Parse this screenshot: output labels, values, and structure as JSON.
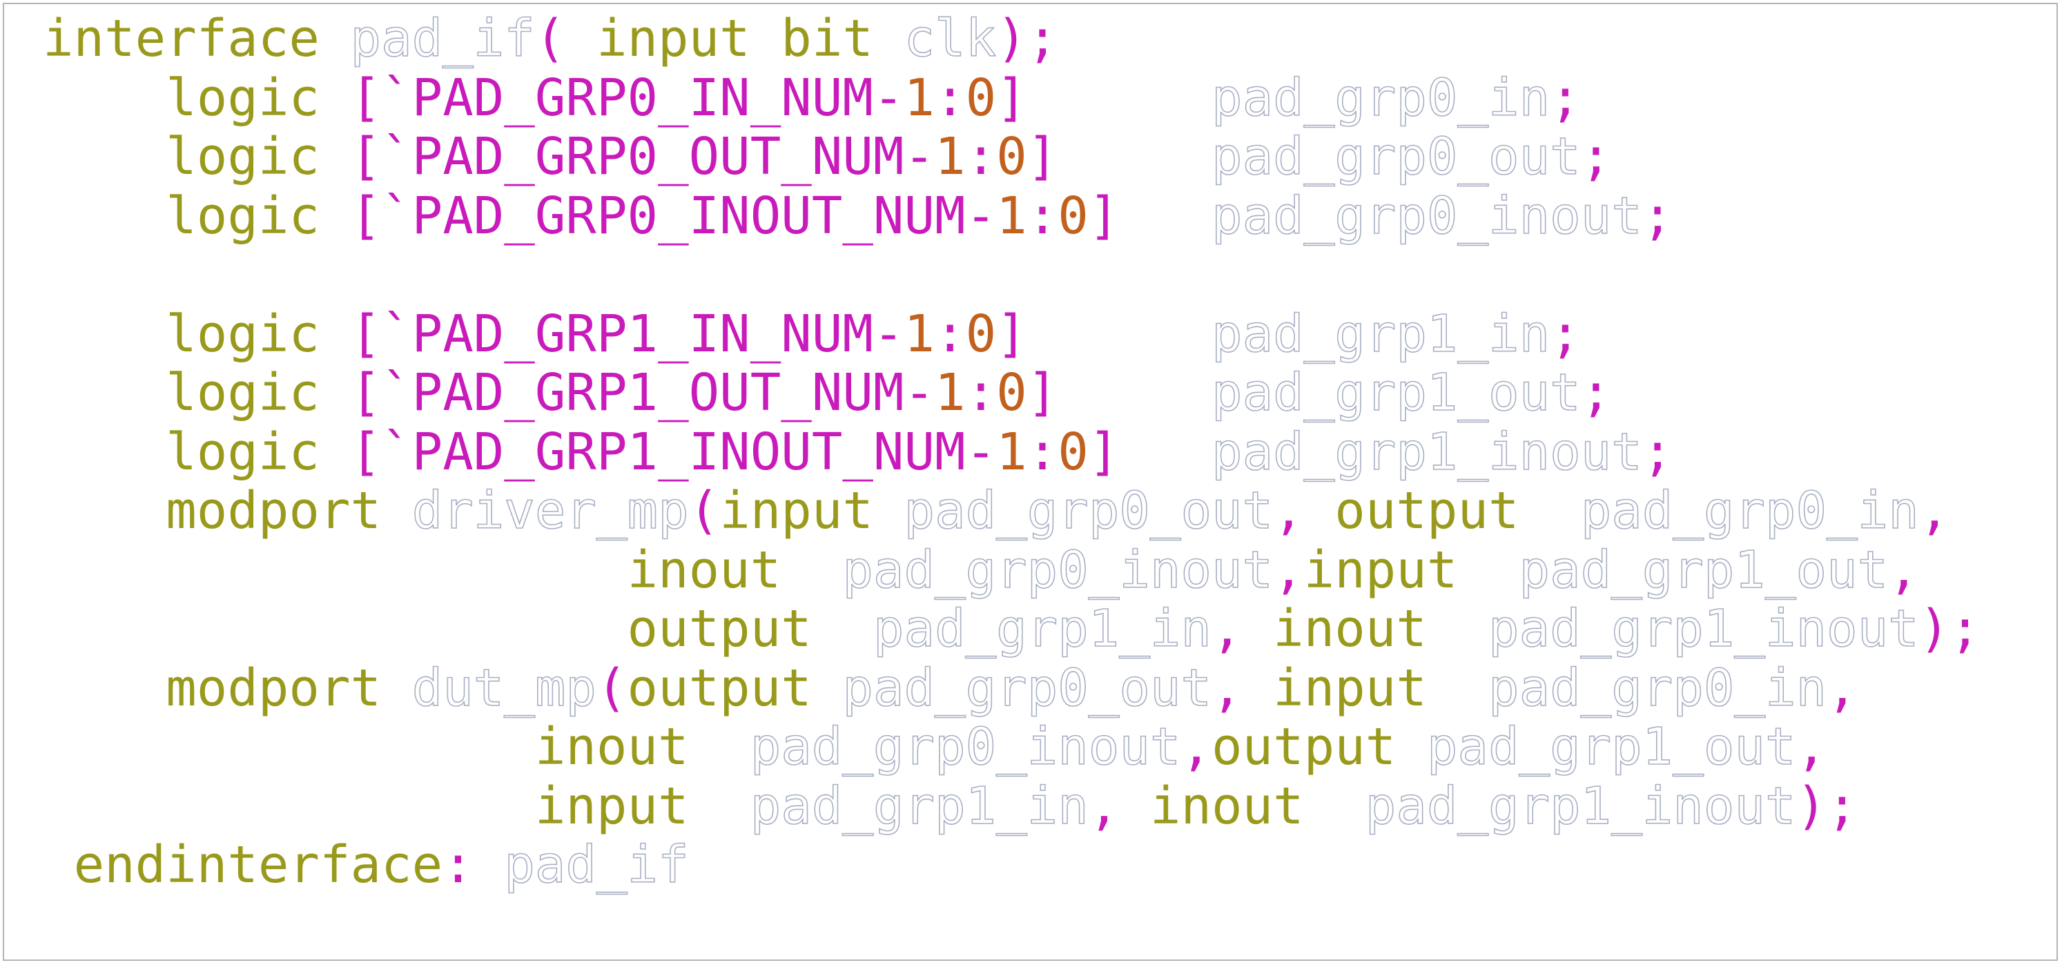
{
  "colors": {
    "keyword": "#999a1c",
    "macro_punct": "#c91bbb",
    "number": "#c2611e",
    "identifier_outline": "#a9b0c4",
    "border": "#b4b4b4"
  },
  "code": {
    "lines": [
      {
        "tokens": [
          {
            "t": "interface",
            "k": "kw"
          },
          {
            "t": " ",
            "k": "ws"
          },
          {
            "t": "pad_if",
            "k": "id"
          },
          {
            "t": "( ",
            "k": "mac"
          },
          {
            "t": "input",
            "k": "kw"
          },
          {
            "t": " ",
            "k": "ws"
          },
          {
            "t": "bit",
            "k": "kw"
          },
          {
            "t": " ",
            "k": "ws"
          },
          {
            "t": "clk",
            "k": "id"
          },
          {
            "t": ");",
            "k": "mac"
          }
        ]
      },
      {
        "tokens": [
          {
            "t": "    ",
            "k": "ws"
          },
          {
            "t": "logic",
            "k": "kw"
          },
          {
            "t": " ",
            "k": "ws"
          },
          {
            "t": "[`PAD_GRP0_IN_NUM-",
            "k": "mac"
          },
          {
            "t": "1",
            "k": "num"
          },
          {
            "t": ":",
            "k": "mac"
          },
          {
            "t": "0",
            "k": "num"
          },
          {
            "t": "]",
            "k": "mac"
          },
          {
            "t": "      ",
            "k": "ws"
          },
          {
            "t": "pad_grp0_in",
            "k": "id"
          },
          {
            "t": ";",
            "k": "mac"
          }
        ]
      },
      {
        "tokens": [
          {
            "t": "    ",
            "k": "ws"
          },
          {
            "t": "logic",
            "k": "kw"
          },
          {
            "t": " ",
            "k": "ws"
          },
          {
            "t": "[`PAD_GRP0_OUT_NUM-",
            "k": "mac"
          },
          {
            "t": "1",
            "k": "num"
          },
          {
            "t": ":",
            "k": "mac"
          },
          {
            "t": "0",
            "k": "num"
          },
          {
            "t": "]",
            "k": "mac"
          },
          {
            "t": "     ",
            "k": "ws"
          },
          {
            "t": "pad_grp0_out",
            "k": "id"
          },
          {
            "t": ";",
            "k": "mac"
          }
        ]
      },
      {
        "tokens": [
          {
            "t": "    ",
            "k": "ws"
          },
          {
            "t": "logic",
            "k": "kw"
          },
          {
            "t": " ",
            "k": "ws"
          },
          {
            "t": "[`PAD_GRP0_INOUT_NUM-",
            "k": "mac"
          },
          {
            "t": "1",
            "k": "num"
          },
          {
            "t": ":",
            "k": "mac"
          },
          {
            "t": "0",
            "k": "num"
          },
          {
            "t": "]",
            "k": "mac"
          },
          {
            "t": "   ",
            "k": "ws"
          },
          {
            "t": "pad_grp0_inout",
            "k": "id"
          },
          {
            "t": ";",
            "k": "mac"
          }
        ]
      },
      {
        "tokens": []
      },
      {
        "tokens": [
          {
            "t": "    ",
            "k": "ws"
          },
          {
            "t": "logic",
            "k": "kw"
          },
          {
            "t": " ",
            "k": "ws"
          },
          {
            "t": "[`PAD_GRP1_IN_NUM-",
            "k": "mac"
          },
          {
            "t": "1",
            "k": "num"
          },
          {
            "t": ":",
            "k": "mac"
          },
          {
            "t": "0",
            "k": "num"
          },
          {
            "t": "]",
            "k": "mac"
          },
          {
            "t": "      ",
            "k": "ws"
          },
          {
            "t": "pad_grp1_in",
            "k": "id"
          },
          {
            "t": ";",
            "k": "mac"
          }
        ]
      },
      {
        "tokens": [
          {
            "t": "    ",
            "k": "ws"
          },
          {
            "t": "logic",
            "k": "kw"
          },
          {
            "t": " ",
            "k": "ws"
          },
          {
            "t": "[`PAD_GRP1_OUT_NUM-",
            "k": "mac"
          },
          {
            "t": "1",
            "k": "num"
          },
          {
            "t": ":",
            "k": "mac"
          },
          {
            "t": "0",
            "k": "num"
          },
          {
            "t": "]",
            "k": "mac"
          },
          {
            "t": "     ",
            "k": "ws"
          },
          {
            "t": "pad_grp1_out",
            "k": "id"
          },
          {
            "t": ";",
            "k": "mac"
          }
        ]
      },
      {
        "tokens": [
          {
            "t": "    ",
            "k": "ws"
          },
          {
            "t": "logic",
            "k": "kw"
          },
          {
            "t": " ",
            "k": "ws"
          },
          {
            "t": "[`PAD_GRP1_INOUT_NUM-",
            "k": "mac"
          },
          {
            "t": "1",
            "k": "num"
          },
          {
            "t": ":",
            "k": "mac"
          },
          {
            "t": "0",
            "k": "num"
          },
          {
            "t": "]",
            "k": "mac"
          },
          {
            "t": "   ",
            "k": "ws"
          },
          {
            "t": "pad_grp1_inout",
            "k": "id"
          },
          {
            "t": ";",
            "k": "mac"
          }
        ]
      },
      {
        "tokens": [
          {
            "t": "    ",
            "k": "ws"
          },
          {
            "t": "modport",
            "k": "kw"
          },
          {
            "t": " ",
            "k": "ws"
          },
          {
            "t": "driver_mp",
            "k": "id"
          },
          {
            "t": "(",
            "k": "mac"
          },
          {
            "t": "input",
            "k": "kw"
          },
          {
            "t": " ",
            "k": "ws"
          },
          {
            "t": "pad_grp0_out",
            "k": "id"
          },
          {
            "t": ",",
            "k": "mac"
          },
          {
            "t": " ",
            "k": "ws"
          },
          {
            "t": "output",
            "k": "kw"
          },
          {
            "t": "  ",
            "k": "ws"
          },
          {
            "t": "pad_grp0_in",
            "k": "id"
          },
          {
            "t": ",",
            "k": "mac"
          }
        ]
      },
      {
        "tokens": [
          {
            "t": "                   ",
            "k": "ws"
          },
          {
            "t": "inout",
            "k": "kw"
          },
          {
            "t": "  ",
            "k": "ws"
          },
          {
            "t": "pad_grp0_inout",
            "k": "id"
          },
          {
            "t": ",",
            "k": "mac"
          },
          {
            "t": "input",
            "k": "kw"
          },
          {
            "t": "  ",
            "k": "ws"
          },
          {
            "t": "pad_grp1_out",
            "k": "id"
          },
          {
            "t": ",",
            "k": "mac"
          }
        ]
      },
      {
        "tokens": [
          {
            "t": "                   ",
            "k": "ws"
          },
          {
            "t": "output",
            "k": "kw"
          },
          {
            "t": "  ",
            "k": "ws"
          },
          {
            "t": "pad_grp1_in",
            "k": "id"
          },
          {
            "t": ",",
            "k": "mac"
          },
          {
            "t": " ",
            "k": "ws"
          },
          {
            "t": "inout",
            "k": "kw"
          },
          {
            "t": "  ",
            "k": "ws"
          },
          {
            "t": "pad_grp1_inout",
            "k": "id"
          },
          {
            "t": ");",
            "k": "mac"
          }
        ]
      },
      {
        "tokens": [
          {
            "t": "    ",
            "k": "ws"
          },
          {
            "t": "modport",
            "k": "kw"
          },
          {
            "t": " ",
            "k": "ws"
          },
          {
            "t": "dut_mp",
            "k": "id"
          },
          {
            "t": "(",
            "k": "mac"
          },
          {
            "t": "output",
            "k": "kw"
          },
          {
            "t": " ",
            "k": "ws"
          },
          {
            "t": "pad_grp0_out",
            "k": "id"
          },
          {
            "t": ",",
            "k": "mac"
          },
          {
            "t": " ",
            "k": "ws"
          },
          {
            "t": "input",
            "k": "kw"
          },
          {
            "t": "  ",
            "k": "ws"
          },
          {
            "t": "pad_grp0_in",
            "k": "id"
          },
          {
            "t": ",",
            "k": "mac"
          }
        ]
      },
      {
        "tokens": [
          {
            "t": "                ",
            "k": "ws"
          },
          {
            "t": "inout",
            "k": "kw"
          },
          {
            "t": "  ",
            "k": "ws"
          },
          {
            "t": "pad_grp0_inout",
            "k": "id"
          },
          {
            "t": ",",
            "k": "mac"
          },
          {
            "t": "output",
            "k": "kw"
          },
          {
            "t": " ",
            "k": "ws"
          },
          {
            "t": "pad_grp1_out",
            "k": "id"
          },
          {
            "t": ",",
            "k": "mac"
          }
        ]
      },
      {
        "tokens": [
          {
            "t": "                ",
            "k": "ws"
          },
          {
            "t": "input",
            "k": "kw"
          },
          {
            "t": "  ",
            "k": "ws"
          },
          {
            "t": "pad_grp1_in",
            "k": "id"
          },
          {
            "t": ",",
            "k": "mac"
          },
          {
            "t": " ",
            "k": "ws"
          },
          {
            "t": "inout",
            "k": "kw"
          },
          {
            "t": "  ",
            "k": "ws"
          },
          {
            "t": "pad_grp1_inout",
            "k": "id"
          },
          {
            "t": ");",
            "k": "mac"
          }
        ]
      },
      {
        "tokens": [
          {
            "t": " ",
            "k": "ws"
          },
          {
            "t": "endinterface",
            "k": "kw"
          },
          {
            "t": ":",
            "k": "mac"
          },
          {
            "t": " ",
            "k": "ws"
          },
          {
            "t": "pad_if",
            "k": "id"
          }
        ]
      }
    ]
  }
}
